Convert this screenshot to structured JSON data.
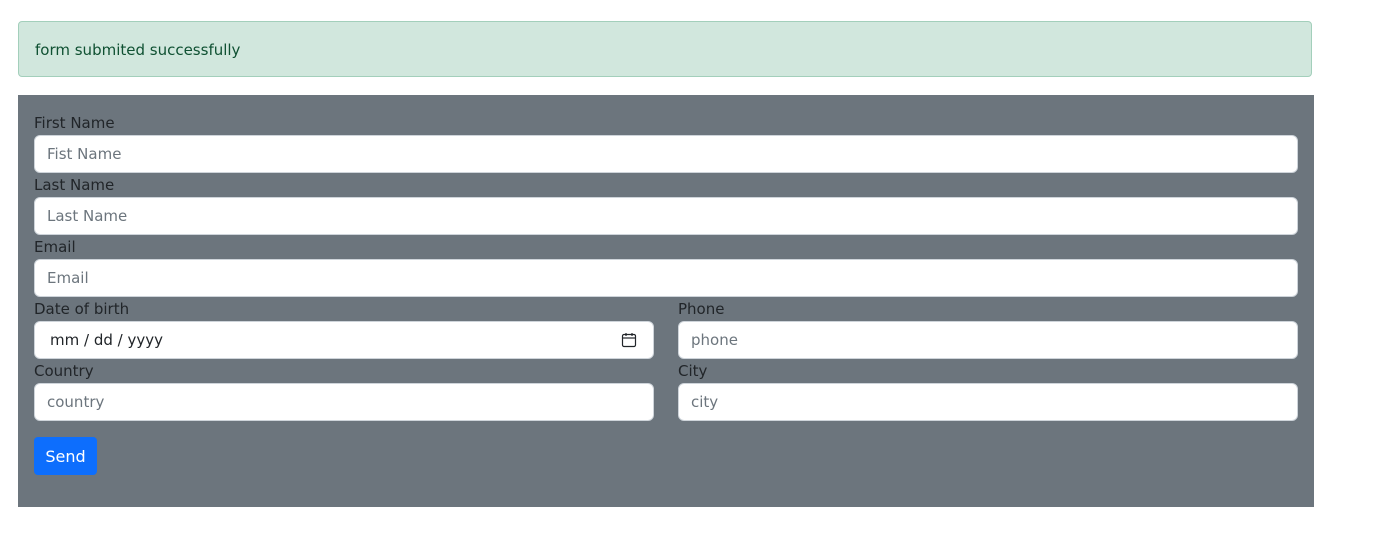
{
  "alert": {
    "message": "form submited successfully"
  },
  "form": {
    "first_name": {
      "label": "First Name",
      "placeholder": "Fist Name",
      "value": ""
    },
    "last_name": {
      "label": "Last Name",
      "placeholder": "Last Name",
      "value": ""
    },
    "email": {
      "label": "Email",
      "placeholder": "Email",
      "value": ""
    },
    "date_of_birth": {
      "label": "Date of birth",
      "display": "mm / dd / yyyy",
      "icon": "calendar-icon"
    },
    "phone": {
      "label": "Phone",
      "placeholder": "phone",
      "value": ""
    },
    "country": {
      "label": "Country",
      "placeholder": "country",
      "value": ""
    },
    "city": {
      "label": "City",
      "placeholder": "city",
      "value": ""
    },
    "send_label": "Send"
  },
  "colors": {
    "alert_bg": "#d1e7dd",
    "alert_text": "#0f5132",
    "panel_bg": "#6c757d",
    "primary": "#0d6efd"
  }
}
